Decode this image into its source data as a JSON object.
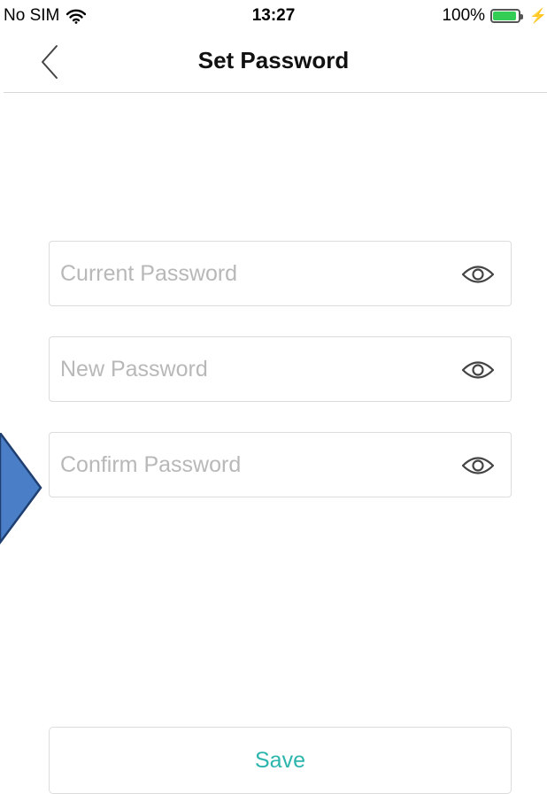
{
  "status_bar": {
    "carrier": "No SIM",
    "time": "13:27",
    "battery_percent": "100%",
    "battery_level": 1.0,
    "wifi_icon": "wifi-icon",
    "battery_color": "#33cc55"
  },
  "nav": {
    "title": "Set Password",
    "back_icon": "chevron-left-icon"
  },
  "form": {
    "current_password": {
      "placeholder": "Current Password",
      "value": "",
      "toggle_icon": "eye-icon"
    },
    "new_password": {
      "placeholder": "New Password",
      "value": "",
      "toggle_icon": "eye-icon"
    },
    "confirm_password": {
      "placeholder": "Confirm Password",
      "value": "",
      "toggle_icon": "eye-icon"
    }
  },
  "save_button": {
    "label": "Save",
    "color": "#2bb5ad"
  },
  "annotation": {
    "arrow_icon": "pointer-arrow-icon",
    "arrow_color": "#4a7fc8"
  }
}
